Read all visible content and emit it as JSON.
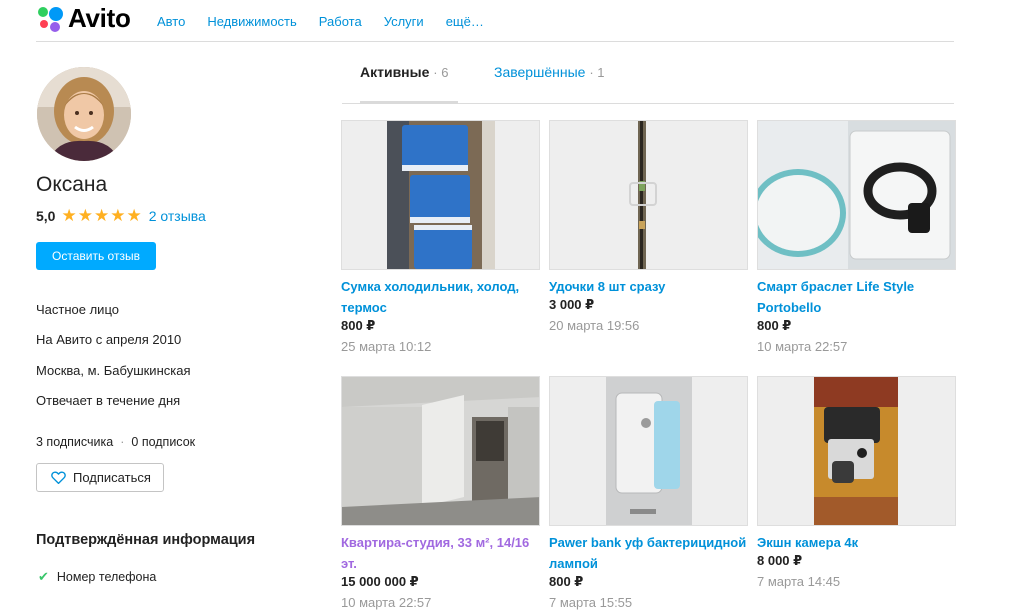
{
  "header": {
    "logo_text": "Avito",
    "nav": [
      "Авто",
      "Недвижимость",
      "Работа",
      "Услуги",
      "ещё…"
    ]
  },
  "profile": {
    "name": "Оксана",
    "rating": "5,0",
    "stars": 5,
    "reviews_link": "2 отзыва",
    "leave_review_button": "Оставить отзыв",
    "type": "Частное лицо",
    "since": "На Авито с апреля 2010",
    "location": "Москва, м. Бабушкинская",
    "response": "Отвечает в течение дня",
    "subscribers": "3 подписчика",
    "subscriptions": "0 подписок",
    "subscribe_button": "Подписаться",
    "verified_title": "Подтверждённая информация",
    "verified_items": [
      "Номер телефона"
    ]
  },
  "tabs": [
    {
      "label": "Активные",
      "count": "· 6",
      "active": true
    },
    {
      "label": "Завершённые",
      "count": "· 1",
      "active": false
    }
  ],
  "items": [
    {
      "title": "Сумка холодильник, холод, термос",
      "price": "800 ₽",
      "date": "25 марта 10:12",
      "visited": false
    },
    {
      "title": "Удочки 8 шт сразу",
      "price": "3 000 ₽",
      "date": "20 марта 19:56",
      "visited": false
    },
    {
      "title": "Смарт браслет Life Style Portobello",
      "price": "800 ₽",
      "date": "10 марта 22:57",
      "visited": false
    },
    {
      "title": "Квартира-студия, 33 м², 14/16 эт.",
      "price": "15 000 000 ₽",
      "date": "10 марта 22:57",
      "visited": true
    },
    {
      "title": "Pawer bank уф бактерицидной лампой",
      "price": "800 ₽",
      "date": "7 марта 15:55",
      "visited": false
    },
    {
      "title": "Экшн камера 4к",
      "price": "8 000 ₽",
      "date": "7 марта 14:45",
      "visited": false
    }
  ],
  "colors": {
    "link": "#0091d9",
    "visited": "#a169e0",
    "button": "#00aaff",
    "star": "#ffb021",
    "check": "#39c66b"
  }
}
